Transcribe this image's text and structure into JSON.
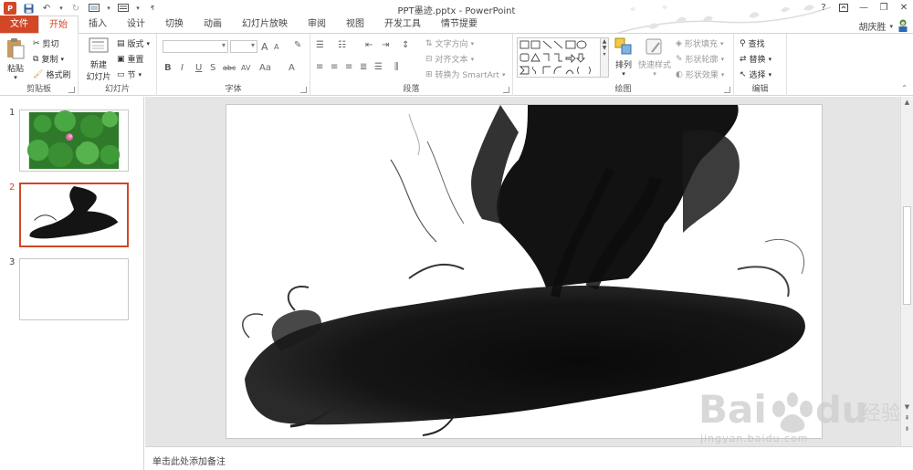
{
  "window": {
    "title": "PPT墨迹.pptx - PowerPoint"
  },
  "user": {
    "name": "胡庆胜"
  },
  "qat": {
    "logo": "P"
  },
  "tabs": [
    {
      "label": "文件"
    },
    {
      "label": "开始"
    },
    {
      "label": "插入"
    },
    {
      "label": "设计"
    },
    {
      "label": "切换"
    },
    {
      "label": "动画"
    },
    {
      "label": "幻灯片放映"
    },
    {
      "label": "审阅"
    },
    {
      "label": "视图"
    },
    {
      "label": "开发工具"
    },
    {
      "label": "情节提要"
    }
  ],
  "ribbon": {
    "clipboard": {
      "label": "剪贴板",
      "paste": "粘贴",
      "cut": "剪切",
      "copy": "复制",
      "format_painter": "格式刷"
    },
    "slides": {
      "label": "幻灯片",
      "new_slide_1": "新建",
      "new_slide_2": "幻灯片",
      "layout": "版式",
      "reset": "重置",
      "section": "节"
    },
    "font": {
      "label": "字体",
      "bold": "B",
      "italic": "I",
      "underline": "U",
      "shadow": "S",
      "strike": "abc",
      "spacing": "AV",
      "case": "Aa",
      "color": "A",
      "grow": "A",
      "shrink": "A"
    },
    "paragraph": {
      "label": "段落",
      "text_direction": "文字方向",
      "align_text": "对齐文本",
      "convert_smartart": "转换为 SmartArt"
    },
    "drawing": {
      "label": "绘图",
      "arrange": "排列",
      "quick_styles": "快速样式",
      "shape_fill": "形状填充",
      "shape_outline": "形状轮廓",
      "shape_effects": "形状效果"
    },
    "editing": {
      "label": "编辑",
      "find": "查找",
      "replace": "替换",
      "select": "选择"
    }
  },
  "thumbnails": [
    {
      "number": "1"
    },
    {
      "number": "2"
    },
    {
      "number": "3"
    }
  ],
  "notes": {
    "placeholder": "单击此处添加备注"
  },
  "watermark": {
    "text": "jingyan.baidu.com"
  }
}
